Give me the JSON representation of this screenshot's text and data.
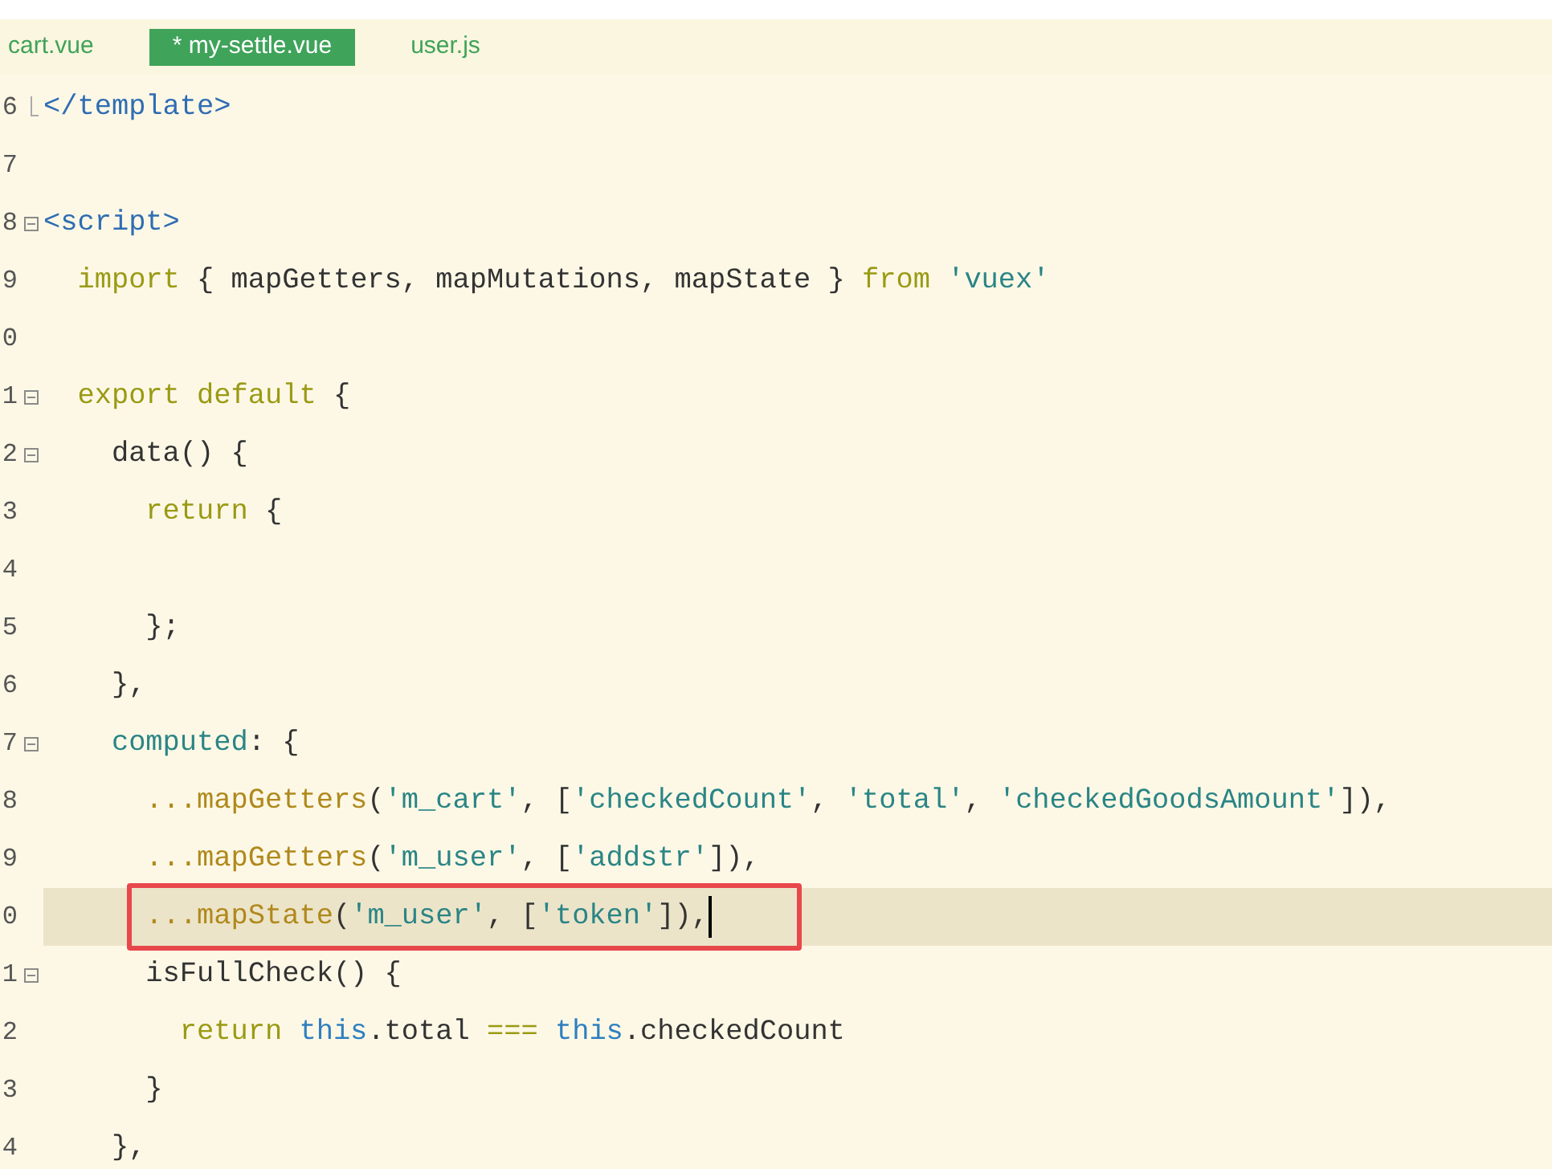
{
  "tabs": [
    {
      "label": "cart.vue",
      "selected": false
    },
    {
      "label": "* my-settle.vue",
      "selected": true
    },
    {
      "label": "user.js",
      "selected": false
    }
  ],
  "lines": [
    {
      "number": "6",
      "fold_end": true,
      "tokens": [
        {
          "kind": "tag",
          "text": "</template>"
        }
      ]
    },
    {
      "number": "7"
    },
    {
      "number": "8",
      "foldable": true,
      "tokens": [
        {
          "kind": "tag",
          "text": "<script>"
        }
      ]
    },
    {
      "number": "9",
      "tokens": [
        {
          "kind": "keyword",
          "text": "  import"
        },
        {
          "kind": "plain",
          "text": " { mapGetters, mapMutations, mapState } "
        },
        {
          "kind": "keyword",
          "text": "from"
        },
        {
          "kind": "string",
          "text": " 'vuex'"
        }
      ]
    },
    {
      "number": "0"
    },
    {
      "number": "1",
      "foldable": true,
      "tokens": [
        {
          "kind": "keyword",
          "text": "  export default"
        },
        {
          "kind": "plain",
          "text": " {"
        }
      ]
    },
    {
      "number": "2",
      "foldable": true,
      "tokens": [
        {
          "kind": "plain",
          "text": "    data() {"
        }
      ]
    },
    {
      "number": "3",
      "tokens": [
        {
          "kind": "keyword",
          "text": "      return"
        },
        {
          "kind": "plain",
          "text": " {"
        }
      ]
    },
    {
      "number": "4"
    },
    {
      "number": "5",
      "tokens": [
        {
          "kind": "plain",
          "text": "      };"
        }
      ]
    },
    {
      "number": "6",
      "tokens": [
        {
          "kind": "plain",
          "text": "    },"
        }
      ]
    },
    {
      "number": "7",
      "foldable": true,
      "tokens": [
        {
          "kind": "string",
          "text": "    computed"
        },
        {
          "kind": "plain",
          "text": ": {"
        }
      ]
    },
    {
      "number": "8",
      "tokens": [
        {
          "kind": "func",
          "text": "      ...mapGetters"
        },
        {
          "kind": "plain",
          "text": "("
        },
        {
          "kind": "string",
          "text": "'m_cart'"
        },
        {
          "kind": "plain",
          "text": ", ["
        },
        {
          "kind": "string",
          "text": "'checkedCount'"
        },
        {
          "kind": "plain",
          "text": ", "
        },
        {
          "kind": "string",
          "text": "'total'"
        },
        {
          "kind": "plain",
          "text": ", "
        },
        {
          "kind": "string",
          "text": "'checkedGoodsAmount'"
        },
        {
          "kind": "plain",
          "text": "]),"
        }
      ]
    },
    {
      "number": "9",
      "tokens": [
        {
          "kind": "func",
          "text": "      ...mapGetters"
        },
        {
          "kind": "plain",
          "text": "("
        },
        {
          "kind": "string",
          "text": "'m_user'"
        },
        {
          "kind": "plain",
          "text": ", ["
        },
        {
          "kind": "string",
          "text": "'addstr'"
        },
        {
          "kind": "plain",
          "text": "]),"
        }
      ]
    },
    {
      "number": "0",
      "highlighted": true,
      "marked": true,
      "cursor": true,
      "tokens": [
        {
          "kind": "func",
          "text": "      ...mapState"
        },
        {
          "kind": "plain",
          "text": "("
        },
        {
          "kind": "string",
          "text": "'m_user'"
        },
        {
          "kind": "plain",
          "text": ", ["
        },
        {
          "kind": "string",
          "text": "'token'"
        },
        {
          "kind": "plain",
          "text": "]),"
        }
      ]
    },
    {
      "number": "1",
      "foldable": true,
      "tokens": [
        {
          "kind": "plain",
          "text": "      isFullCheck() {"
        }
      ]
    },
    {
      "number": "2",
      "tokens": [
        {
          "kind": "keyword",
          "text": "        return "
        },
        {
          "kind": "this",
          "text": "this"
        },
        {
          "kind": "plain",
          "text": ".total "
        },
        {
          "kind": "keyword",
          "text": "=== "
        },
        {
          "kind": "this",
          "text": "this"
        },
        {
          "kind": "plain",
          "text": ".checkedCount"
        }
      ]
    },
    {
      "number": "3",
      "tokens": [
        {
          "kind": "plain",
          "text": "      }"
        }
      ]
    },
    {
      "number": "4",
      "tokens": [
        {
          "kind": "plain",
          "text": "    },"
        }
      ]
    }
  ]
}
